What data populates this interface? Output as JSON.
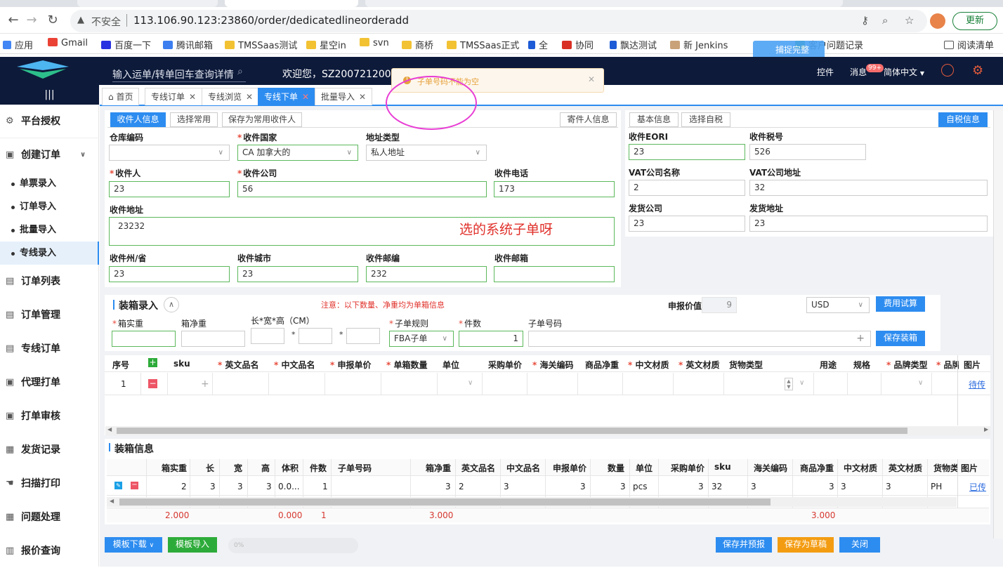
{
  "browser": {
    "insecure_label": "不安全",
    "url": "113.106.90.123:23860/order/dedicatedlineorderadd",
    "update_label": "更新",
    "bookmarks": [
      "应用",
      "Gmail",
      "百度一下",
      "腾讯邮箱",
      "TMSSaas测试",
      "星空in",
      "svn",
      "商桥",
      "TMSSaas正式",
      "全",
      "协同",
      "飘达测试",
      "新 Jenkins",
      "客户问题记录",
      "阅读清单"
    ],
    "overlay_label": "捕捉完整"
  },
  "header": {
    "search_placeholder": "输入运单/转单回车查询详情",
    "welcome": "欢迎您，SZ20072120000",
    "controls_label": "控件",
    "messages_label": "消息",
    "messages_badge": "99+",
    "language_label": "简体中文"
  },
  "toast": {
    "message": "子单号码不能为空"
  },
  "annotation_text": "选的系统子单呀",
  "sidebar": {
    "items": [
      {
        "label": "平台授权"
      },
      {
        "label": "创建订单"
      },
      {
        "label": "单票录入"
      },
      {
        "label": "订单导入"
      },
      {
        "label": "批量导入"
      },
      {
        "label": "专线录入"
      },
      {
        "label": "订单列表"
      },
      {
        "label": "订单管理"
      },
      {
        "label": "专线订单"
      },
      {
        "label": "代理打单"
      },
      {
        "label": "打单审核"
      },
      {
        "label": "发货记录"
      },
      {
        "label": "扫描打印"
      },
      {
        "label": "问题处理"
      },
      {
        "label": "报价查询"
      }
    ]
  },
  "tabs": [
    "首页",
    "专线订单",
    "专线浏览",
    "专线下单",
    "批量导入"
  ],
  "receiver": {
    "tabs": [
      "收件人信息",
      "选择常用",
      "保存为常用收件人",
      "寄件人信息"
    ],
    "labels": {
      "warehouse": "仓库编码",
      "country": "收件国家",
      "address_type": "地址类型",
      "name": "收件人",
      "company": "收件公司",
      "phone": "收件电话",
      "address": "收件地址",
      "state": "收件州/省",
      "city": "收件城市",
      "zip": "收件邮编",
      "email": "收件邮箱"
    },
    "values": {
      "warehouse": "",
      "country": "CA 加拿大的",
      "address_type": "私人地址",
      "name": "23",
      "company": "56",
      "phone": "173",
      "address": "23232",
      "state": "23",
      "city": "23",
      "zip": "232",
      "email": ""
    }
  },
  "basic": {
    "tabs": [
      "基本信息",
      "选择自税",
      "自税信息"
    ],
    "labels": {
      "eori": "收件EORI",
      "tax": "收件税号",
      "vat_name": "VAT公司名称",
      "vat_addr": "VAT公司地址",
      "ship_company": "发货公司",
      "ship_addr": "发货地址"
    },
    "values": {
      "eori": "23",
      "tax": "526",
      "vat_name": "2",
      "vat_addr": "32",
      "ship_company": "23",
      "ship_addr": "23"
    }
  },
  "packing": {
    "title": "装箱录入",
    "notice": "注意：以下数量、净重均为单箱信息",
    "declared_label": "申报价值",
    "declared_value": "9",
    "currency": "USD",
    "fee_button": "费用试算",
    "labels": {
      "gross": "箱实重",
      "net": "箱净重",
      "dims": "长*宽*高（CM）",
      "rule": "子单规则",
      "pieces": "件数",
      "sub_no": "子单号码"
    },
    "values": {
      "rule": "FBA子单",
      "pieces": "1"
    },
    "save_button": "保存装箱",
    "columns": [
      "序号",
      "sku",
      "英文品名",
      "中文品名",
      "申报单价",
      "单箱数量",
      "单位",
      "采购单价",
      "海关编码",
      "商品净重",
      "中文材质",
      "英文材质",
      "货物类型",
      "用途",
      "规格",
      "品牌类型",
      "品牌",
      "图片"
    ],
    "row": {
      "index": "1",
      "image_link": "待传"
    }
  },
  "box_info": {
    "title": "装箱信息",
    "columns": [
      "箱实重",
      "长",
      "宽",
      "高",
      "体积",
      "件数",
      "子单号码",
      "箱净重",
      "英文品名",
      "中文品名",
      "申报单价",
      "数量",
      "单位",
      "采购单价",
      "sku",
      "海关编码",
      "商品净重",
      "中文材质",
      "英文材质",
      "货物类",
      "图片"
    ],
    "row": [
      "2",
      "3",
      "3",
      "3",
      "0.0...",
      "1",
      "",
      "3",
      "2",
      "3",
      "3",
      "3",
      "pcs",
      "3",
      "32",
      "3",
      "3",
      "3",
      "3",
      "PH",
      "已传"
    ],
    "totals": {
      "gross": "2.000",
      "volume": "0.000",
      "pieces": "1",
      "net": "3.000",
      "goods_net": "3.000"
    }
  },
  "footer": {
    "template_download": "模板下载",
    "template_import": "模板导入",
    "progress": "0%",
    "save_forecast": "保存并预报",
    "save_draft": "保存为草稿",
    "close": "关闭"
  }
}
